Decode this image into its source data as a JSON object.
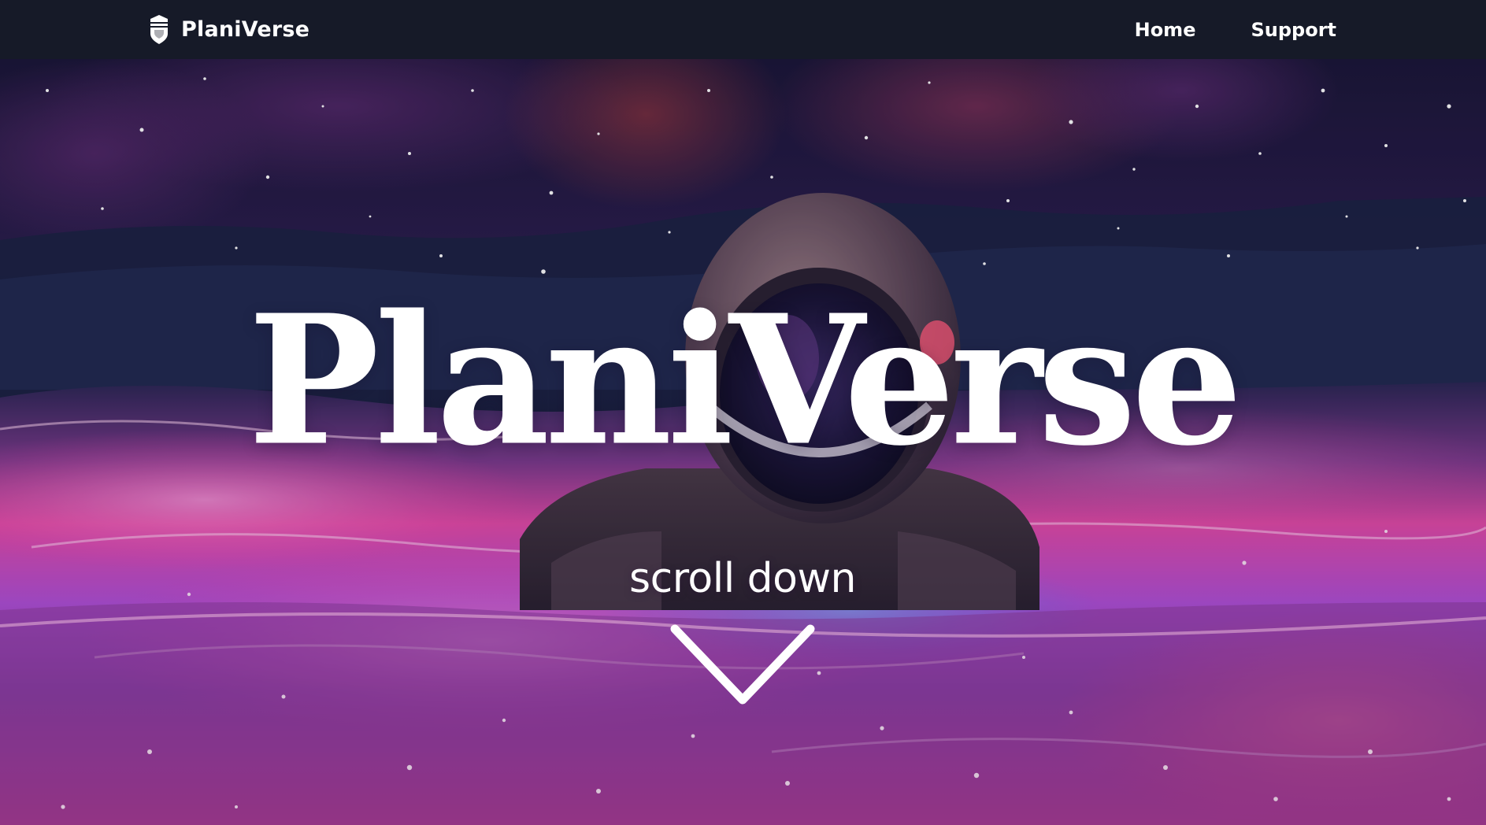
{
  "navbar": {
    "brand_name": "PlaniVerse",
    "brand_icon": "shield-badge-icon",
    "links": [
      {
        "label": "Home"
      },
      {
        "label": "Support"
      }
    ]
  },
  "hero": {
    "title": "PlaniVerse",
    "scroll_label": "scroll down",
    "scroll_icon": "chevron-down-icon"
  },
  "colors": {
    "nav_background": "#161a28",
    "text": "#ffffff",
    "nebula_pink": "#ff3ea8",
    "nebula_purple": "#6b2fa0",
    "space_navy": "#1a1736"
  }
}
